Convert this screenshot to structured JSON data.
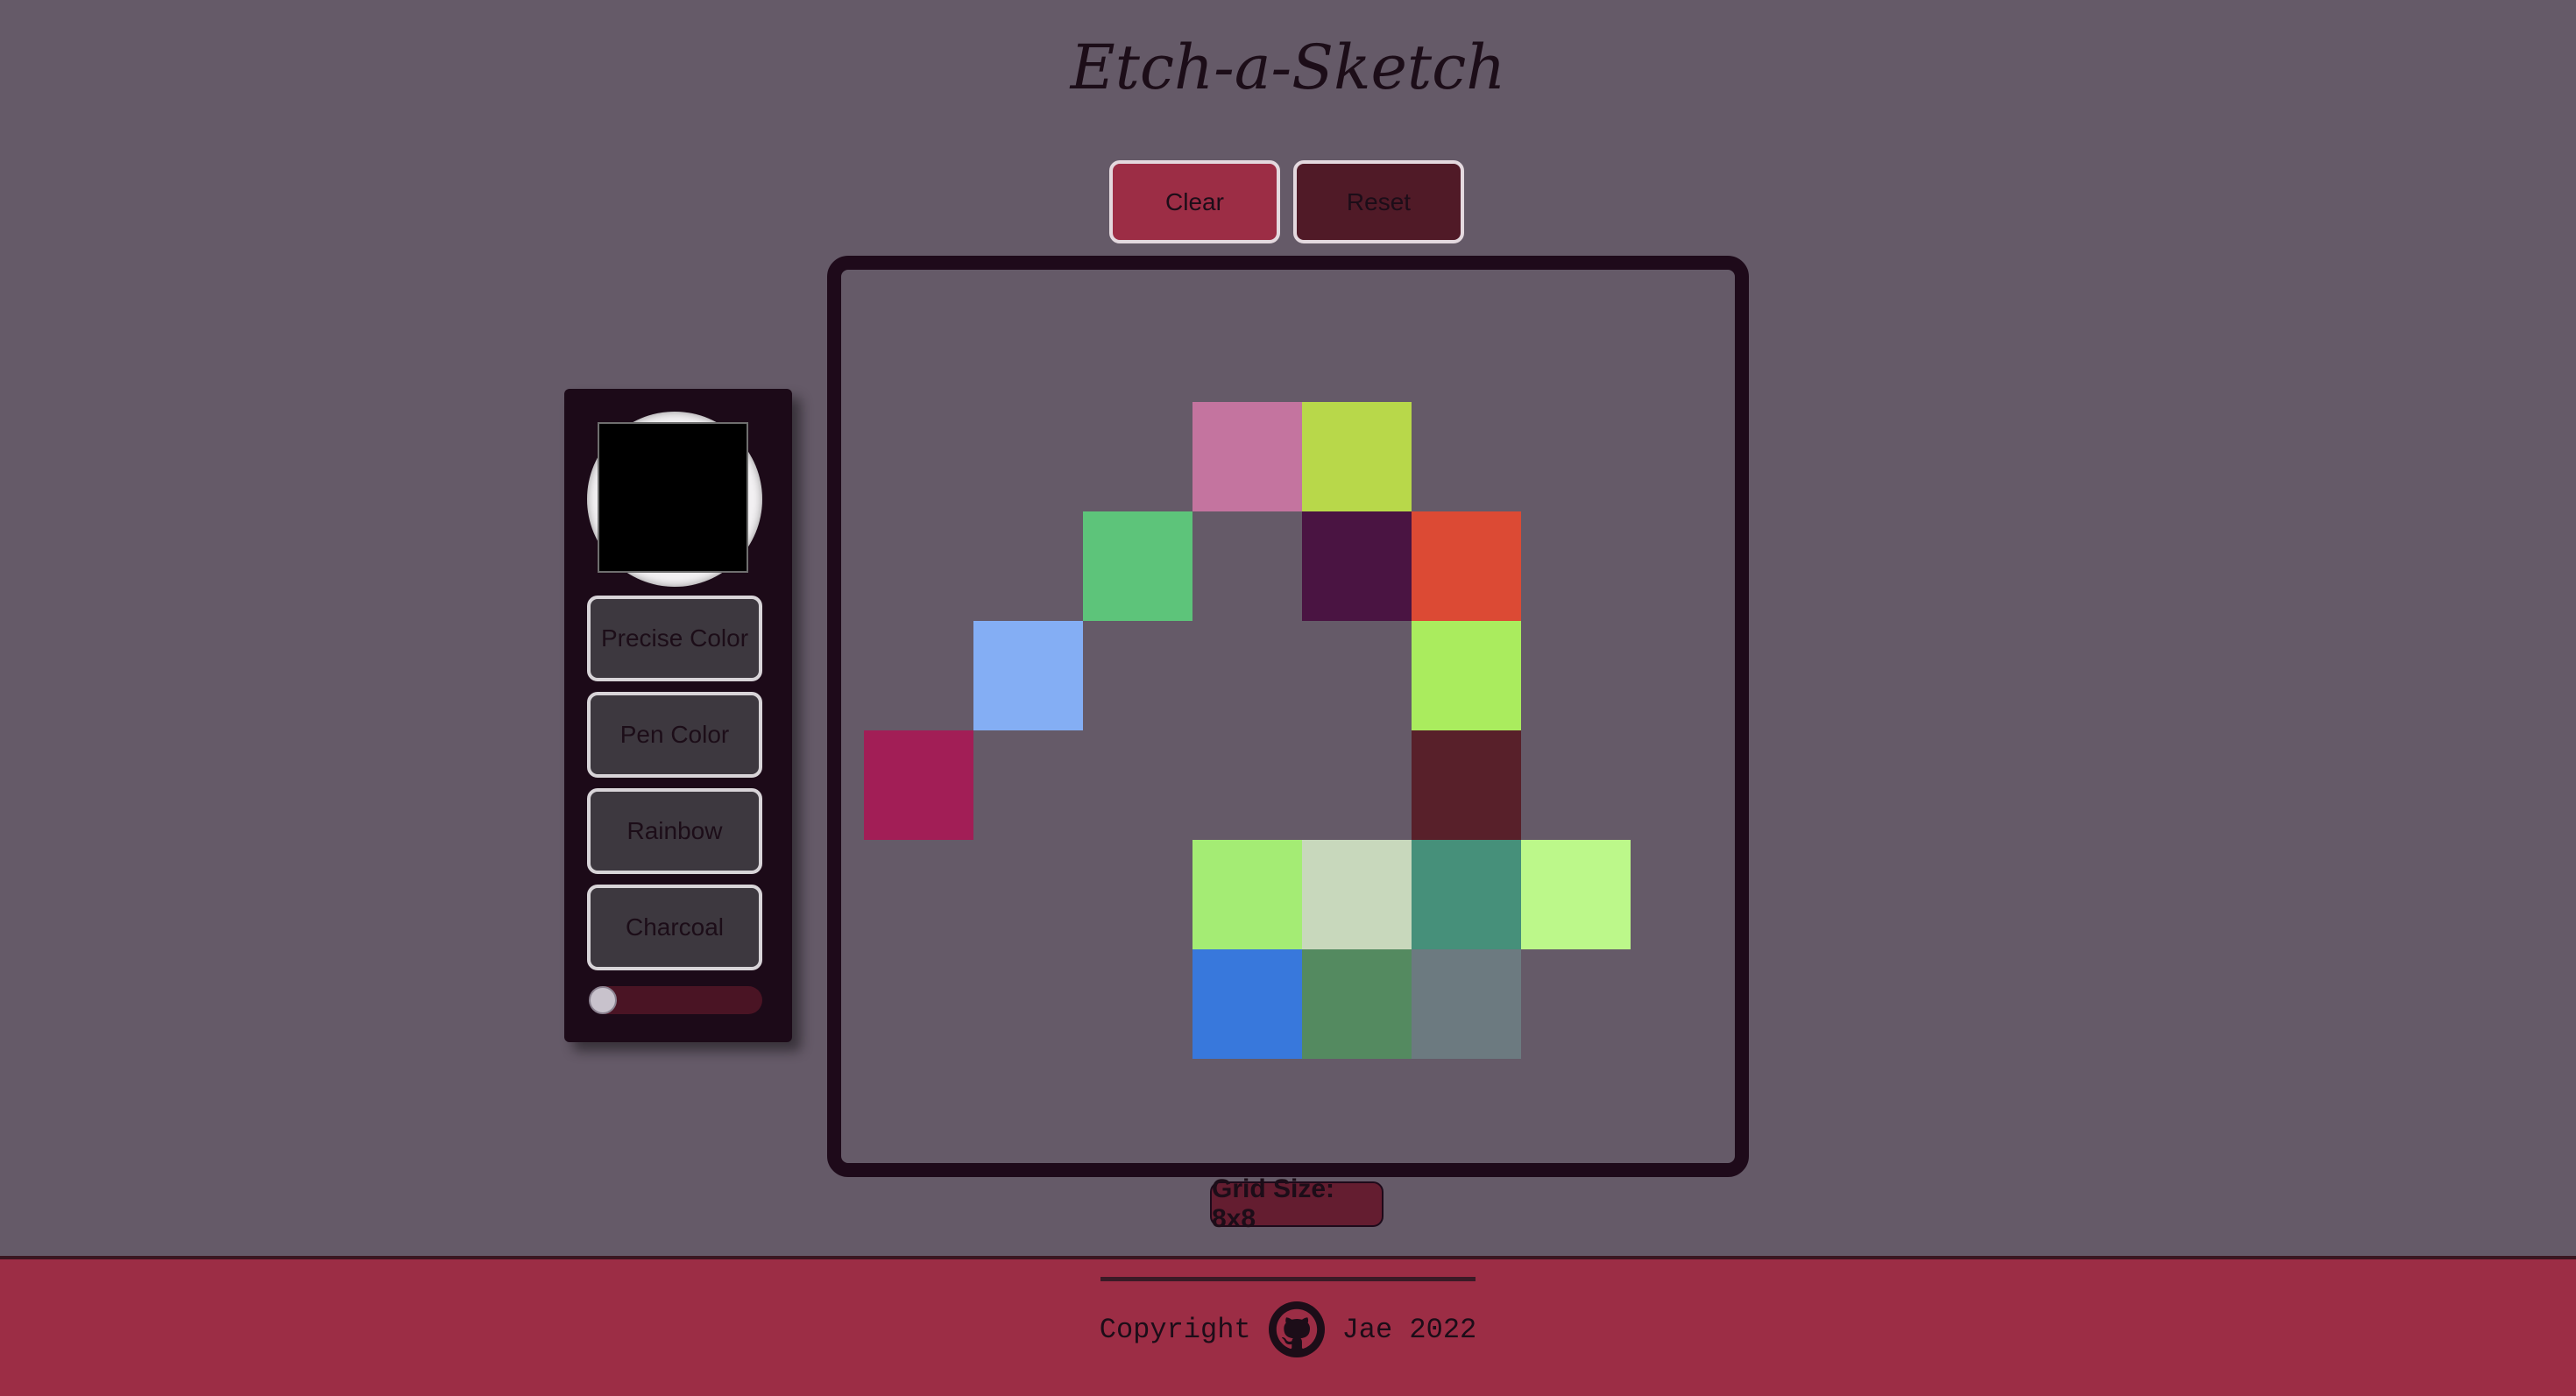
{
  "app": {
    "title": "Etch-a-Sketch"
  },
  "controls": {
    "clear_label": "Clear",
    "reset_label": "Reset"
  },
  "side_panel": {
    "current_color": "#000000",
    "modes": [
      {
        "label": "Precise Color"
      },
      {
        "label": "Pen Color"
      },
      {
        "label": "Rainbow"
      },
      {
        "label": "Charcoal"
      }
    ],
    "size_slider_fraction": 0
  },
  "board": {
    "rows": 8,
    "cols": 8,
    "background": "#655a68",
    "cells": [
      {
        "row": 1,
        "col": 3,
        "color": "#c4749f"
      },
      {
        "row": 1,
        "col": 4,
        "color": "#b8d84a"
      },
      {
        "row": 2,
        "col": 2,
        "color": "#5dc47a"
      },
      {
        "row": 2,
        "col": 4,
        "color": "#4a1442"
      },
      {
        "row": 2,
        "col": 5,
        "color": "#dc4a34"
      },
      {
        "row": 3,
        "col": 1,
        "color": "#84aef4"
      },
      {
        "row": 3,
        "col": 5,
        "color": "#aaec5e"
      },
      {
        "row": 4,
        "col": 0,
        "color": "#a21e56"
      },
      {
        "row": 4,
        "col": 5,
        "color": "#58202a"
      },
      {
        "row": 5,
        "col": 3,
        "color": "#a4ec74"
      },
      {
        "row": 5,
        "col": 4,
        "color": "#c8d8bc"
      },
      {
        "row": 5,
        "col": 5,
        "color": "#46907a"
      },
      {
        "row": 5,
        "col": 6,
        "color": "#bcf88a"
      },
      {
        "row": 6,
        "col": 3,
        "color": "#3878dc"
      },
      {
        "row": 6,
        "col": 4,
        "color": "#548a60"
      },
      {
        "row": 6,
        "col": 5,
        "color": "#6c7a80"
      }
    ]
  },
  "grid_size_label": "Grid Size: 8x8",
  "footer": {
    "copyright_text": "Copyright",
    "author_text": "Jae 2022",
    "icon": "github-icon"
  }
}
